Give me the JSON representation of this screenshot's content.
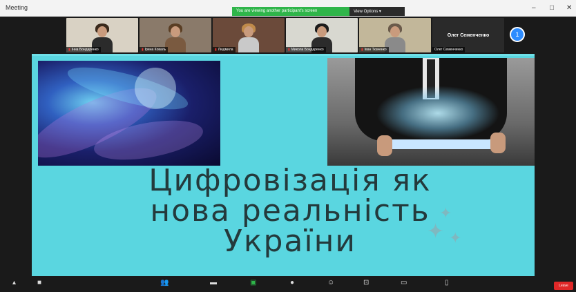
{
  "window": {
    "title": "Meeting"
  },
  "banner": {
    "share_text": "You are viewing another participant's screen",
    "options_label": "View Options",
    "options_chevron": "▾"
  },
  "window_controls": {
    "minimize": "–",
    "restore": "□",
    "close": "✕"
  },
  "participants": [
    {
      "name": "Інна Бондаренко",
      "bg": "#d9d2c4",
      "hair": "#3a2a1c",
      "body": "#2b2b2b"
    },
    {
      "name": "Ірина Коваль",
      "bg": "#8a7a6a",
      "hair": "#5a3e24",
      "body": "#7a5a40"
    },
    {
      "name": "Людмила",
      "bg": "#6b4a3a",
      "hair": "#c08a4a",
      "body": "#c9c9c9"
    },
    {
      "name": "Микола Бондаренко",
      "bg": "#d8d8d0",
      "hair": "#1c1c1c",
      "body": "#2b2b2b"
    },
    {
      "name": "Іван Ткаченко",
      "bg": "#c2b79a",
      "hair": "#6a5a4a",
      "body": "#8a8a8a"
    }
  ],
  "featured_tile": {
    "name": "Олег Семенченко",
    "label": "Олег Семенченко"
  },
  "more_button": {
    "label": "1"
  },
  "slide": {
    "title_line1": "Цифровізація як",
    "title_line2": "нова реальність",
    "title_line3": "України"
  },
  "toolbar": {
    "end_label": "Leave"
  },
  "icons": {
    "mic": "mic-muted-icon",
    "video": "video-icon",
    "participants": "participants-icon",
    "chat": "chat-icon",
    "share": "share-screen-icon",
    "record": "record-icon",
    "reactions": "reactions-icon",
    "apps": "apps-icon",
    "whiteboard": "whiteboard-icon",
    "notes": "notes-icon"
  }
}
